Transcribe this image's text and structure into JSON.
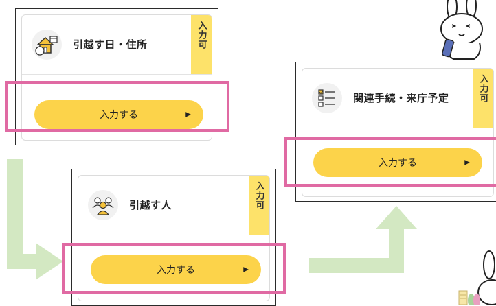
{
  "cards": [
    {
      "title": "引越す日・住所",
      "badge": "入力可",
      "button": "入力する",
      "icon": "house-calendar-icon"
    },
    {
      "title": "引越す人",
      "badge": "入力可",
      "button": "入力する",
      "icon": "people-icon"
    },
    {
      "title": "関連手続・来庁予定",
      "badge": "入力可",
      "button": "入力する",
      "icon": "checklist-icon"
    }
  ],
  "colors": {
    "highlight": "#e06aa3",
    "button": "#fcd34a",
    "badge": "#fde26a",
    "flow_arrow": "#d3e8c2"
  }
}
